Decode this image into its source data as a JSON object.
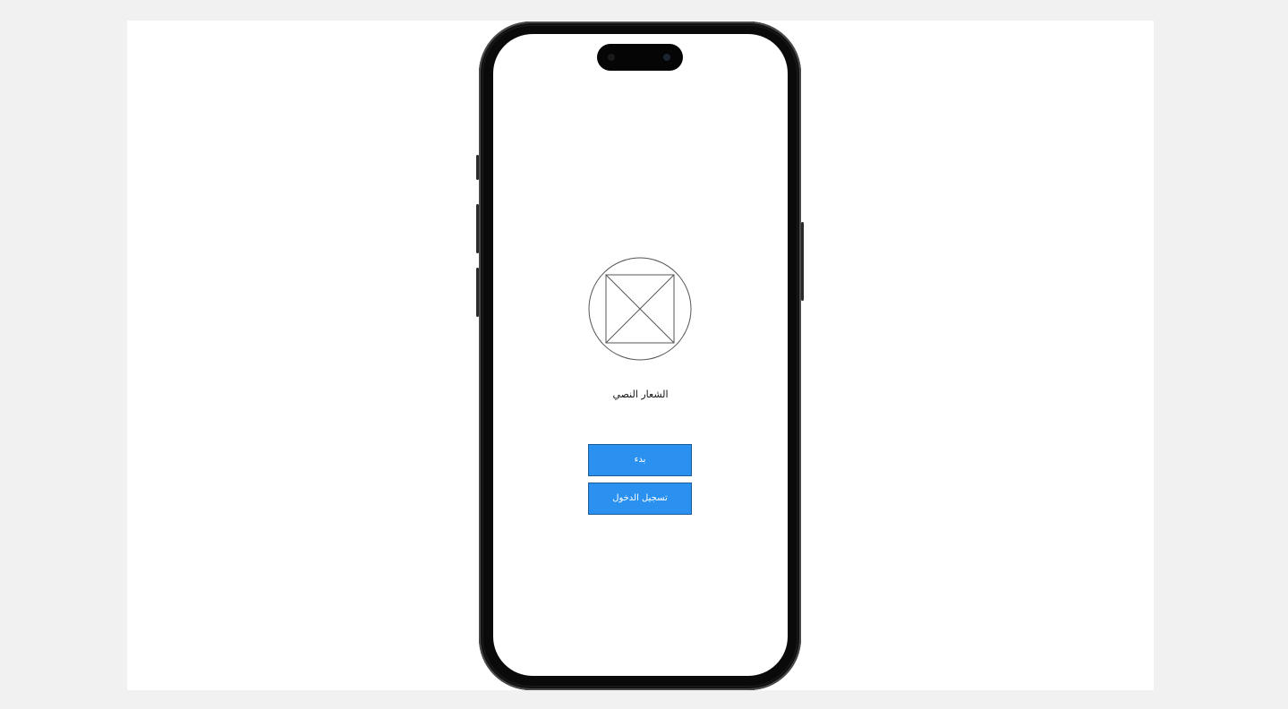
{
  "app": {
    "logo_icon": "image-placeholder-icon",
    "brand_text": "الشعار النصي"
  },
  "actions": {
    "start_label": "بدء",
    "login_label": "تسجيل الدخول"
  },
  "colors": {
    "button_bg": "#2a91f0",
    "button_border": "#1c5c99",
    "button_text": "#ffffff",
    "frame": "#1b1b1b"
  }
}
